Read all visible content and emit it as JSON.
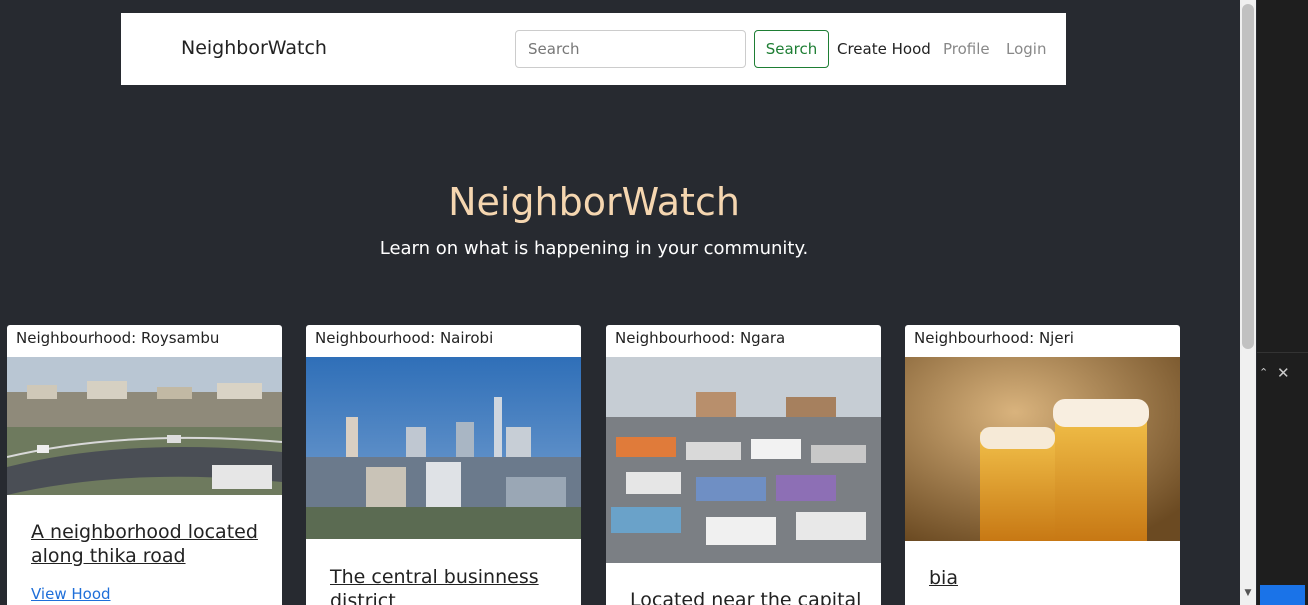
{
  "navbar": {
    "brand": "NeighborWatch",
    "search_placeholder": "Search",
    "search_button": "Search",
    "links": [
      "Create Hood",
      "Profile",
      "Login"
    ]
  },
  "hero": {
    "title": "NeighborWatch",
    "subtitle": "Learn on what is happening in your community."
  },
  "cards": [
    {
      "header": "Neighbourhood: Roysambu",
      "title": "A neighborhood located along thika road",
      "link": "View Hood"
    },
    {
      "header": "Neighbourhood: Nairobi",
      "title": "The central businness district",
      "link": ""
    },
    {
      "header": "Neighbourhood: Ngara",
      "title": "Located near the capital",
      "link": ""
    },
    {
      "header": "Neighbourhood: Njeri",
      "title": "bia",
      "link": ""
    }
  ],
  "colors": {
    "page_bg": "#272a30",
    "hero_title": "#f5d6b0",
    "search_button": "#1e7e34",
    "link": "#1f6fd9"
  }
}
